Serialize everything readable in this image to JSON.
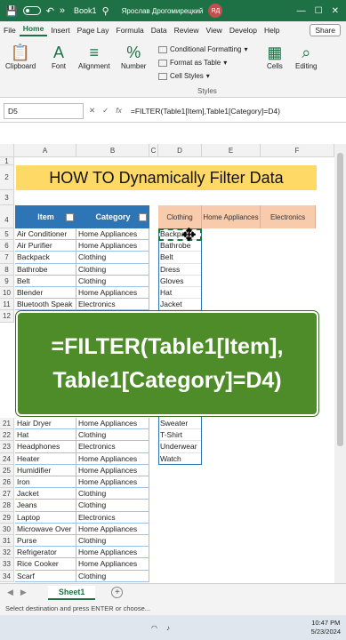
{
  "titlebar": {
    "workbook": "Book1",
    "user": "Ярослав Дрогомирецкий",
    "initials": "ЯД",
    "autosave_icon": "save-icon",
    "undo_icon": "undo-icon",
    "search_icon": "search-icon"
  },
  "ribbon_tabs": [
    "File",
    "Home",
    "Insert",
    "Page Lay",
    "Formula",
    "Data",
    "Review",
    "View",
    "Develop",
    "Help"
  ],
  "share_label": "Share",
  "ribbon": {
    "clipboard": "Clipboard",
    "font": "Font",
    "alignment": "Alignment",
    "number": "Number",
    "conditional_formatting": "Conditional Formatting",
    "format_as_table": "Format as Table",
    "cell_styles": "Cell Styles",
    "styles_group": "Styles",
    "cells": "Cells",
    "editing": "Editing"
  },
  "formula_bar": {
    "name_box": "D5",
    "formula": "=FILTER(Table1[Item],Table1[Category]=D4)"
  },
  "columns": [
    "A",
    "B",
    "C",
    "D",
    "E",
    "F"
  ],
  "rows_top": [
    "1",
    "2",
    "3",
    "4"
  ],
  "banner": "HOW TO Dynamically Filter Data",
  "table": {
    "headers": [
      "Item",
      "Category"
    ],
    "rows_upper": [
      {
        "row": "5",
        "item": "Air Conditioner",
        "category": "Home Appliances"
      },
      {
        "row": "6",
        "item": "Air Purifier",
        "category": "Home Appliances"
      },
      {
        "row": "7",
        "item": "Backpack",
        "category": "Clothing"
      },
      {
        "row": "8",
        "item": "Bathrobe",
        "category": "Clothing"
      },
      {
        "row": "9",
        "item": "Belt",
        "category": "Clothing"
      },
      {
        "row": "10",
        "item": "Blender",
        "category": "Home Appliances"
      },
      {
        "row": "11",
        "item": "Bluetooth Speak",
        "category": "Electronics"
      },
      {
        "row": "12",
        "item": "",
        "category": ""
      }
    ],
    "rows_lower": [
      {
        "row": "21",
        "item": "Hair Dryer",
        "category": "Home Appliances"
      },
      {
        "row": "22",
        "item": "Hat",
        "category": "Clothing"
      },
      {
        "row": "23",
        "item": "Headphones",
        "category": "Electronics"
      },
      {
        "row": "24",
        "item": "Heater",
        "category": "Home Appliances"
      },
      {
        "row": "25",
        "item": "Humidifier",
        "category": "Home Appliances"
      },
      {
        "row": "26",
        "item": "Iron",
        "category": "Home Appliances"
      },
      {
        "row": "27",
        "item": "Jacket",
        "category": "Clothing"
      },
      {
        "row": "28",
        "item": "Jeans",
        "category": "Clothing"
      },
      {
        "row": "29",
        "item": "Laptop",
        "category": "Electronics"
      },
      {
        "row": "30",
        "item": "Microwave Over",
        "category": "Home Appliances"
      },
      {
        "row": "31",
        "item": "Purse",
        "category": "Clothing"
      },
      {
        "row": "32",
        "item": "Refrigerator",
        "category": "Home Appliances"
      },
      {
        "row": "33",
        "item": "Rice Cooker",
        "category": "Home Appliances"
      },
      {
        "row": "34",
        "item": "Scarf",
        "category": "Clothing"
      }
    ]
  },
  "criteria_headers": [
    "Clothing",
    "Home Appliances",
    "Electronics"
  ],
  "filtered_upper": [
    "Backpack",
    "Bathrobe",
    "Belt",
    "Dress",
    "Gloves",
    "Hat",
    "Jacket"
  ],
  "filtered_lower": [
    "Sweater",
    "T-Shirt",
    "Underwear",
    "Watch"
  ],
  "overlay": {
    "line1": "=FILTER(Table1[Item],",
    "line2": "Table1[Category]=D4)"
  },
  "sheet_tab": "Sheet1",
  "status": "Select destination and press ENTER or choose...",
  "taskbar": {
    "time": "10:47 PM",
    "date": "5/23/2024"
  }
}
